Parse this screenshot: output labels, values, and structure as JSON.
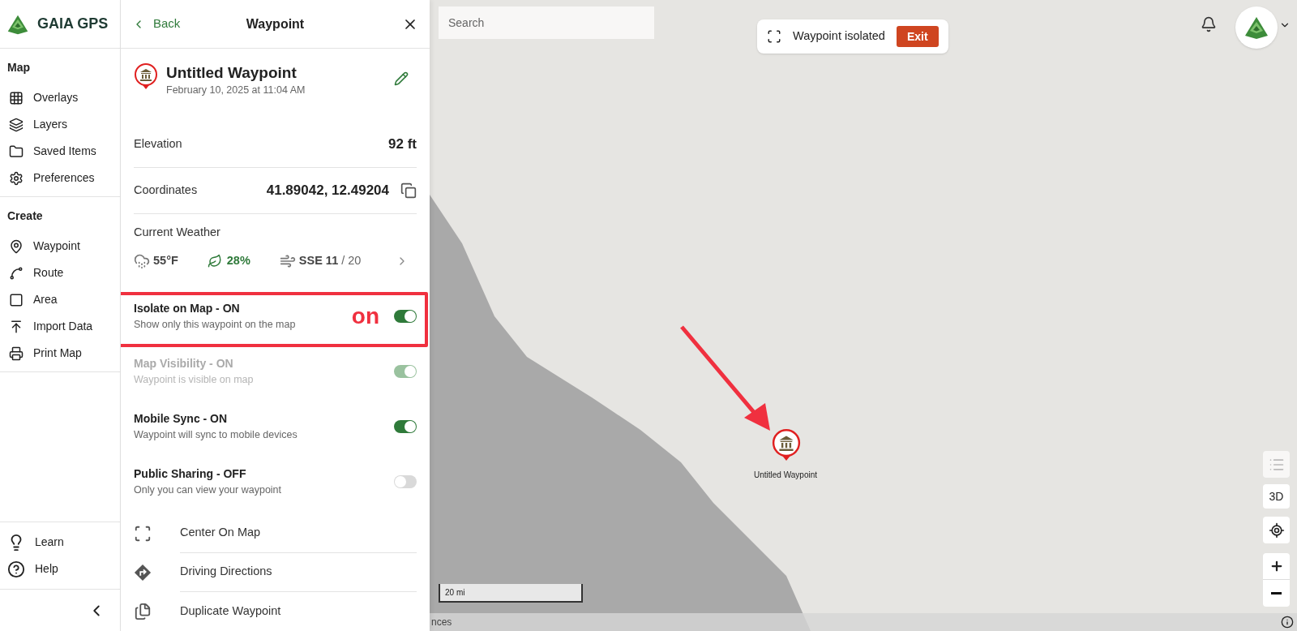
{
  "sidebar": {
    "logo": "GAIA GPS",
    "sections": [
      {
        "title": "Map",
        "items": [
          {
            "label": "Overlays"
          },
          {
            "label": "Layers"
          },
          {
            "label": "Saved Items"
          },
          {
            "label": "Preferences"
          }
        ]
      },
      {
        "title": "Create",
        "items": [
          {
            "label": "Waypoint"
          },
          {
            "label": "Route"
          },
          {
            "label": "Area"
          },
          {
            "label": "Import Data"
          },
          {
            "label": "Print Map"
          }
        ]
      }
    ],
    "footer_items": [
      {
        "label": "Learn"
      },
      {
        "label": "Help"
      }
    ]
  },
  "panel": {
    "back": "Back",
    "title": "Waypoint",
    "waypoint": {
      "name": "Untitled Waypoint",
      "date": "February 10, 2025 at 11:04 AM"
    },
    "details": [
      {
        "label": "Elevation",
        "value": "92 ft",
        "kind": "plain"
      },
      {
        "label": "Coordinates",
        "value": "41.89042, 12.49204",
        "kind": "copy"
      }
    ],
    "weather": {
      "title": "Current Weather",
      "temperature": "55°F",
      "humidity": "28%",
      "wind": "SSE 11",
      "gust": "/ 20"
    },
    "toggles": [
      {
        "title": "Isolate on Map - ON",
        "description": "Show only this waypoint on the map",
        "on": true,
        "disabled": false,
        "highlighted": true
      },
      {
        "title": "Map Visibility - ON",
        "description": "Waypoint is visible on map",
        "on": true,
        "disabled": true,
        "highlighted": false
      },
      {
        "title": "Mobile Sync - ON",
        "description": "Waypoint will sync to mobile devices",
        "on": true,
        "disabled": false,
        "highlighted": false
      },
      {
        "title": "Public Sharing - OFF",
        "description": "Only you can view your waypoint",
        "on": false,
        "disabled": false,
        "highlighted": false
      }
    ],
    "actions": [
      {
        "label": "Center On Map"
      },
      {
        "label": "Driving Directions"
      },
      {
        "label": "Duplicate Waypoint"
      }
    ]
  },
  "annotation": {
    "label": "on"
  },
  "map": {
    "search": {
      "placeholder": "Search"
    },
    "banner": {
      "text": "Waypoint isolated",
      "button": "Exit"
    },
    "marker_label": "Untitled Waypoint",
    "scale": "20 mi",
    "attribution": "nces",
    "view_button": "3D"
  }
}
